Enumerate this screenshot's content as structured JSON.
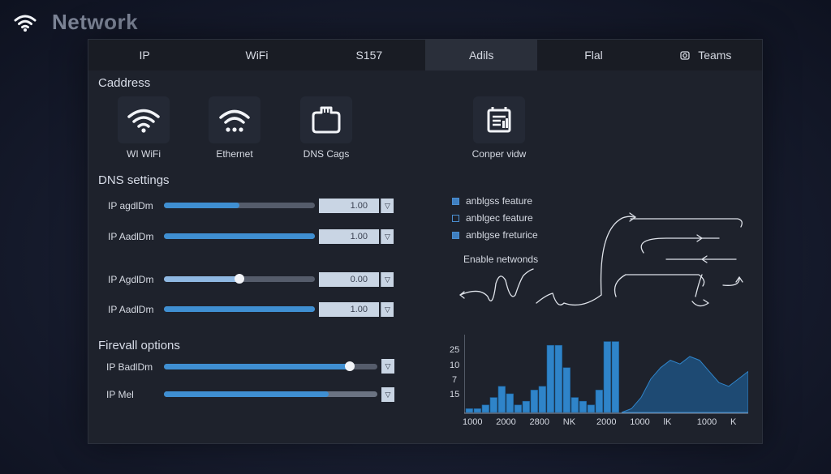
{
  "header": {
    "title": "Network",
    "icon": "wifi-icon"
  },
  "tabs": [
    {
      "label": "IP",
      "active": false
    },
    {
      "label": "WiFi",
      "active": false
    },
    {
      "label": "S157",
      "active": false
    },
    {
      "label": "Adils",
      "active": true
    },
    {
      "label": "Flal",
      "active": false
    },
    {
      "label": "Teams",
      "active": false,
      "icon": "camera-icon"
    }
  ],
  "caddress": {
    "title": "Caddress",
    "tiles": [
      {
        "label": "WI WiFi",
        "icon": "wifi-icon"
      },
      {
        "label": "Ethernet",
        "icon": "ethernet-icon"
      },
      {
        "label": "DNS Cags",
        "icon": "dns-icon"
      },
      {
        "label": "Conper vidw",
        "icon": "device-icon"
      }
    ]
  },
  "dns": {
    "title": "DNS settings",
    "rows": [
      {
        "label": "IP agdlDm",
        "value": "1.00",
        "level": 0.5
      },
      {
        "label": "IP AadlDm",
        "value": "1.00",
        "level": 1.0
      },
      {
        "label": "IP AgdlDm",
        "value": "0.00",
        "level": 0.5
      },
      {
        "label": "IP AadlDm",
        "value": "1.00",
        "level": 1.0
      }
    ]
  },
  "firewall": {
    "title": "Firevall options",
    "rows": [
      {
        "label": "IP BadlDm",
        "level": 0.87
      },
      {
        "label": "IP Mel",
        "level": 0.77
      }
    ]
  },
  "features": [
    {
      "label": "anblgss feature",
      "checked": true
    },
    {
      "label": "anblgec feature",
      "checked": false
    },
    {
      "label": "anblgse freturice",
      "checked": true
    }
  ],
  "enable_label": "Enable netwonds",
  "chart_data": {
    "type": "bar",
    "y_tick_labels": [
      "25",
      "10",
      "7",
      "15"
    ],
    "x_tick_labels": [
      "1000",
      "2000",
      "2800",
      "NK",
      "2000",
      "1000",
      "lK",
      "1000",
      "K"
    ],
    "values": [
      1,
      1,
      2,
      4,
      7,
      5,
      2,
      3,
      6,
      7,
      18,
      18,
      12,
      4,
      3,
      2,
      6,
      19,
      19
    ],
    "area": [
      0,
      1,
      4,
      9,
      12,
      14,
      13,
      15,
      14,
      11,
      8,
      7,
      9,
      11
    ]
  },
  "colors": {
    "accent": "#3f8fd2",
    "panel": "#1e222c",
    "bar": "#2f84c9",
    "area": "#1e4a73"
  }
}
